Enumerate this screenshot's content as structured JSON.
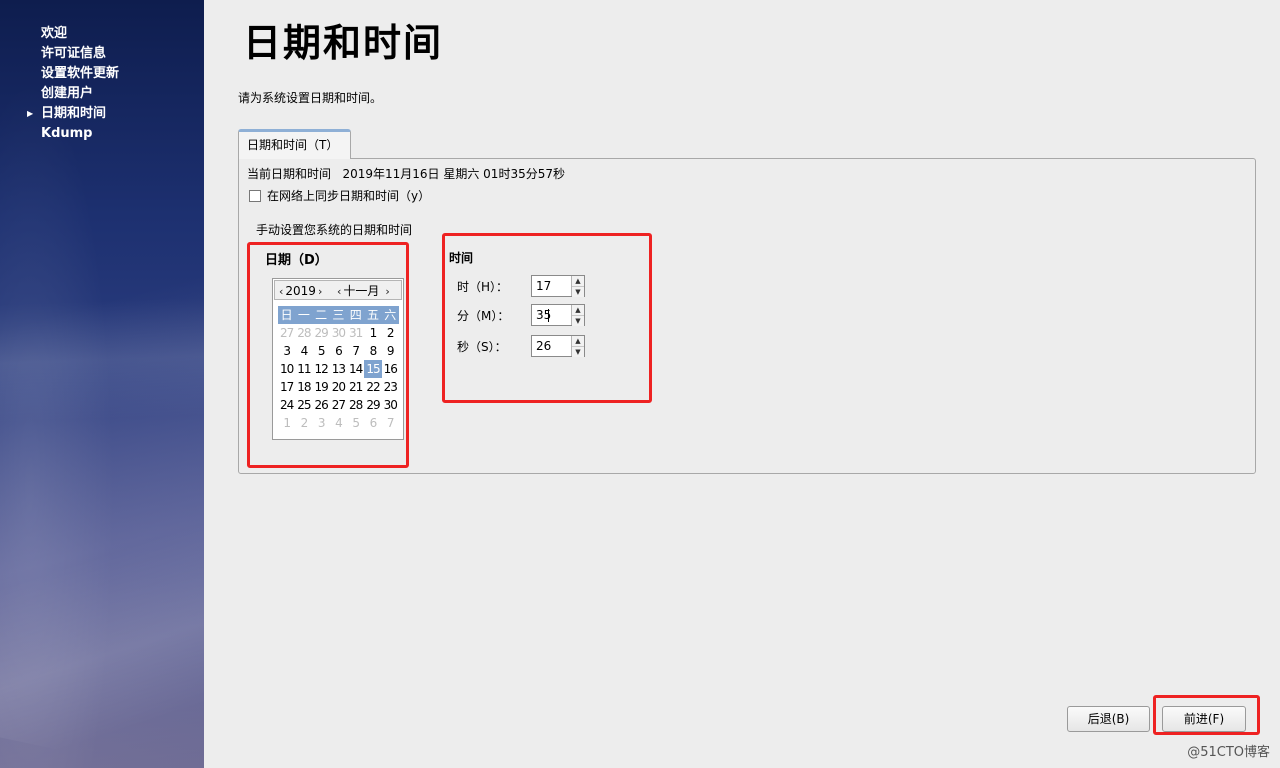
{
  "sidebar": {
    "items": [
      {
        "label": "欢迎"
      },
      {
        "label": "许可证信息"
      },
      {
        "label": "设置软件更新"
      },
      {
        "label": "创建用户"
      },
      {
        "label": "日期和时间"
      },
      {
        "label": "Kdump"
      }
    ],
    "current_index": 4
  },
  "page": {
    "title": "日期和时间",
    "subtitle": "请为系统设置日期和时间。"
  },
  "tab": {
    "label": "日期和时间（T）"
  },
  "current": {
    "label": "当前日期和时间",
    "value": "2019年11月16日 星期六 01时35分57秒"
  },
  "sync": {
    "label": "在网络上同步日期和时间（y）",
    "checked": false
  },
  "manual": {
    "label": "手动设置您系统的日期和时间"
  },
  "date": {
    "title": "日期（D）",
    "year": "2019",
    "month": "十一月",
    "weekdays": [
      "日",
      "一",
      "二",
      "三",
      "四",
      "五",
      "六"
    ],
    "weeks": [
      [
        "27",
        "28",
        "29",
        "30",
        "31",
        "1",
        "2"
      ],
      [
        "3",
        "4",
        "5",
        "6",
        "7",
        "8",
        "9"
      ],
      [
        "10",
        "11",
        "12",
        "13",
        "14",
        "15",
        "16"
      ],
      [
        "17",
        "18",
        "19",
        "20",
        "21",
        "22",
        "23"
      ],
      [
        "24",
        "25",
        "26",
        "27",
        "28",
        "29",
        "30"
      ],
      [
        "1",
        "2",
        "3",
        "4",
        "5",
        "6",
        "7"
      ]
    ],
    "selected": "15"
  },
  "time": {
    "title": "时间",
    "hour": {
      "label": "时（H）：",
      "value": "17"
    },
    "minute": {
      "label": "分（M）：",
      "value": "35"
    },
    "second": {
      "label": "秒（S）：",
      "value": "26"
    }
  },
  "buttons": {
    "back": "后退(B)",
    "forward": "前进(F)"
  },
  "watermark": "@51CTO博客",
  "colors": {
    "highlight": "#ee2222",
    "selection": "#7fa3cf",
    "tab_accent": "#8fb0d6"
  }
}
